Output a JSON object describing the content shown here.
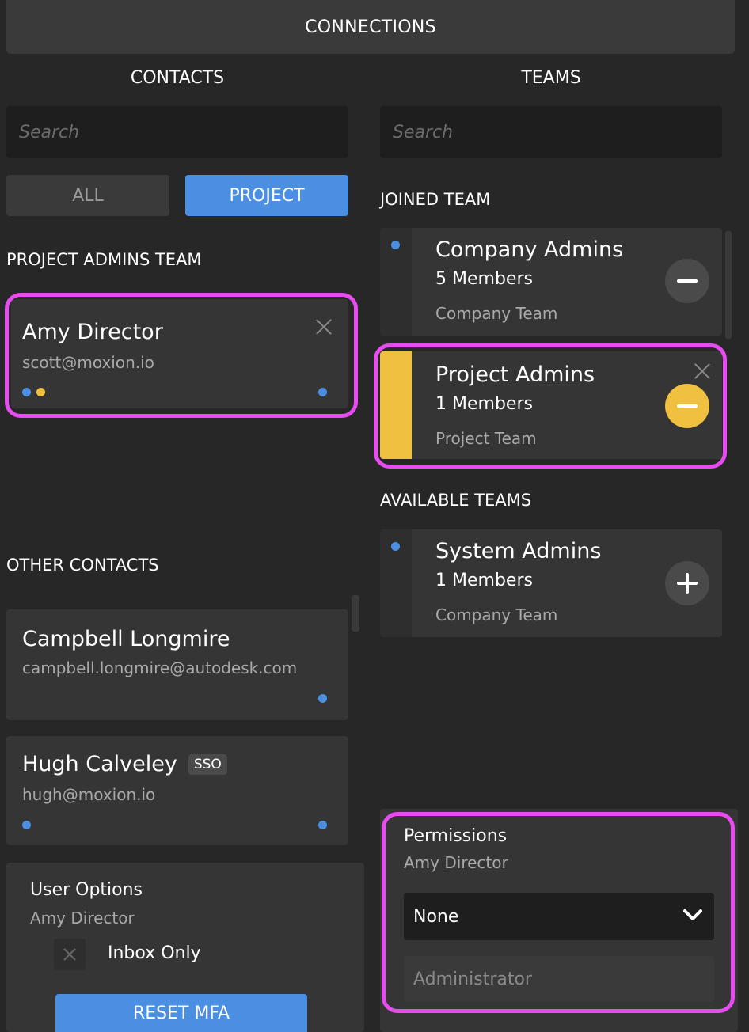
{
  "header": {
    "title": "CONNECTIONS"
  },
  "contacts": {
    "title": "CONTACTS",
    "search_placeholder": "Search",
    "filter": {
      "all_label": "ALL",
      "project_label": "PROJECT",
      "selected": "PROJECT"
    },
    "project_admins_section": "PROJECT ADMINS TEAM",
    "project_admins": [
      {
        "name": "Amy Director",
        "email": "scott@moxion.io"
      }
    ],
    "other_section": "OTHER CONTACTS",
    "other": [
      {
        "name": "Campbell Longmire",
        "email": "campbell.longmire@autodesk.com"
      },
      {
        "name": "Hugh Calveley",
        "email": "hugh@moxion.io",
        "badge": "SSO"
      }
    ]
  },
  "user_options": {
    "title": "User Options",
    "user": "Amy Director",
    "inbox_only_label": "Inbox Only",
    "reset_mfa_label": "RESET MFA"
  },
  "teams": {
    "title": "TEAMS",
    "search_placeholder": "Search",
    "joined_section": "JOINED TEAM",
    "joined": [
      {
        "name": "Company Admins",
        "members": "5 Members",
        "type": "Company Team"
      },
      {
        "name": "Project Admins",
        "members": "1 Members",
        "type": "Project Team"
      }
    ],
    "available_section": "AVAILABLE TEAMS",
    "available": [
      {
        "name": "System Admins",
        "members": "1 Members",
        "type": "Company Team"
      }
    ]
  },
  "permissions": {
    "title": "Permissions",
    "user": "Amy Director",
    "selected": "None",
    "option": "Administrator"
  },
  "colors": {
    "accent_blue": "#4a8fe2",
    "accent_yellow": "#f0c040",
    "highlight_magenta": "#e64cf0",
    "background": "#272727"
  }
}
